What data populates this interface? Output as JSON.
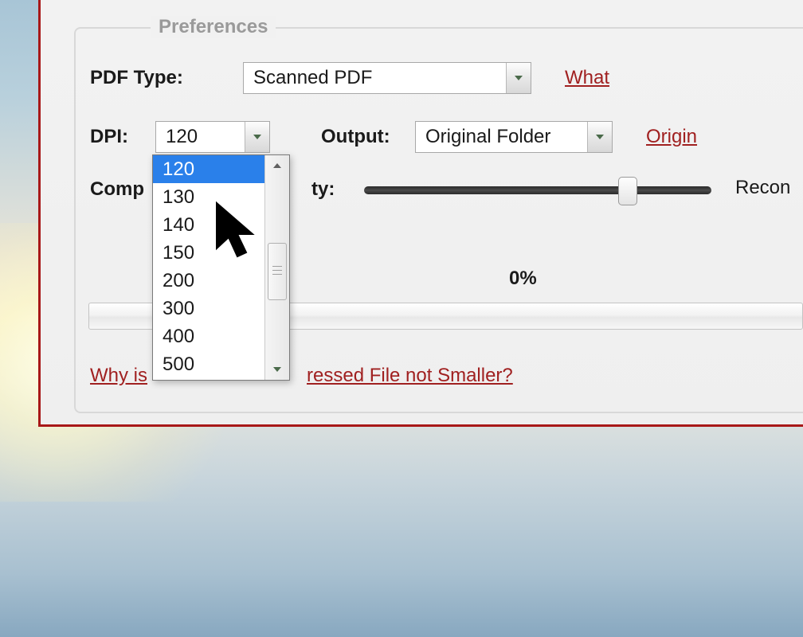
{
  "preferences": {
    "legend": "Preferences",
    "pdfType": {
      "label": "PDF Type:",
      "value": "Scanned PDF",
      "helpLink": "What"
    },
    "dpi": {
      "label": "DPI:",
      "value": "120",
      "options": [
        "120",
        "130",
        "140",
        "150",
        "200",
        "300",
        "400",
        "500"
      ],
      "selectedIndex": 0
    },
    "output": {
      "label": "Output:",
      "value": "Original Folder",
      "helpLink": "Origin"
    },
    "quality": {
      "labelPrefix": "Comp",
      "labelSuffix": "ty:",
      "sliderPercent": 75,
      "rightText": "Recon"
    },
    "progress": {
      "text": "0%"
    },
    "bottomLink": {
      "prefix": "Why is",
      "suffix": "ressed File not Smaller?"
    }
  }
}
